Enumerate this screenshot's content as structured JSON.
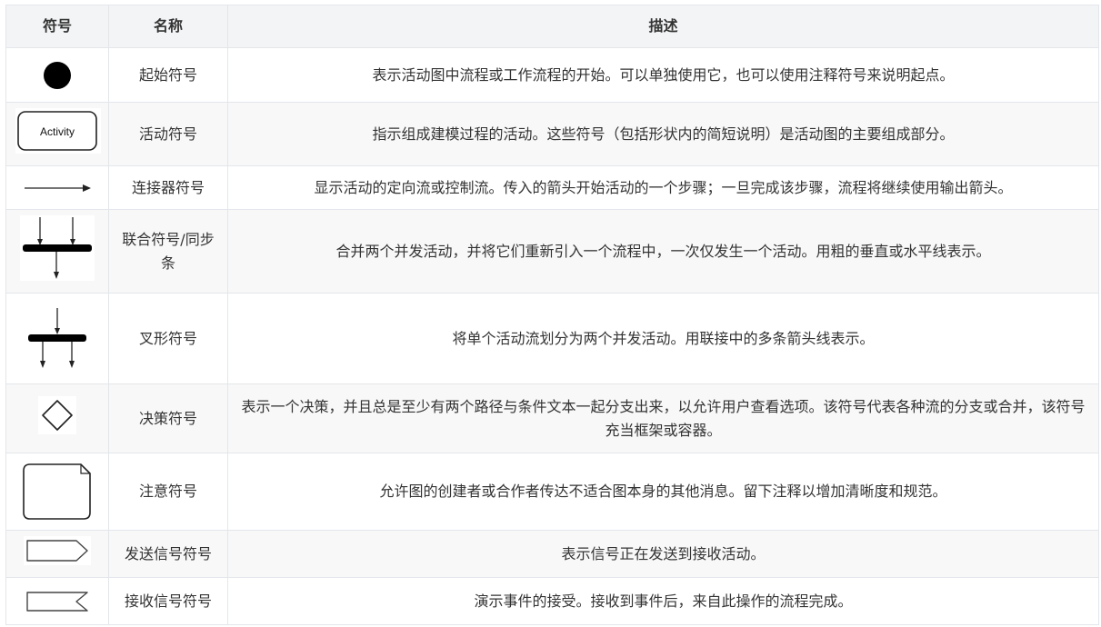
{
  "table": {
    "headers": {
      "symbol": "符号",
      "name": "名称",
      "description": "描述"
    },
    "rows": [
      {
        "icon": "filled-circle-icon",
        "name": "起始符号",
        "description": "表示活动图中流程或工作流程的开始。可以单独使用它，也可以使用注释符号来说明起点。"
      },
      {
        "icon": "activity-rounded-rect-icon",
        "icon_text": "Activity",
        "name": "活动符号",
        "description": "指示组成建模过程的活动。这些符号（包括形状内的简短说明）是活动图的主要组成部分。"
      },
      {
        "icon": "arrow-right-icon",
        "name": "连接器符号",
        "description": "显示活动的定向流或控制流。传入的箭头开始活动的一个步骤；一旦完成该步骤，流程将继续使用输出箭头。"
      },
      {
        "icon": "join-bar-icon",
        "name": "联合符号/同步条",
        "description": "合并两个并发活动，并将它们重新引入一个流程中，一次仅发生一个活动。用粗的垂直或水平线表示。"
      },
      {
        "icon": "fork-bar-icon",
        "name": "叉形符号",
        "description": "将单个活动流划分为两个并发活动。用联接中的多条箭头线表示。"
      },
      {
        "icon": "diamond-icon",
        "name": "决策符号",
        "description": "表示一个决策，并且总是至少有两个路径与条件文本一起分支出来，以允许用户查看选项。该符号代表各种流的分支或合并，该符号充当框架或容器。"
      },
      {
        "icon": "note-icon",
        "name": "注意符号",
        "description": "允许图的创建者或合作者传达不适合图本身的其他消息。留下注释以增加清晰度和规范。"
      },
      {
        "icon": "send-signal-icon",
        "name": "发送信号符号",
        "description": "表示信号正在发送到接收活动。"
      },
      {
        "icon": "receive-signal-icon",
        "name": "接收信号符号",
        "description": "演示事件的接受。接收到事件后，来自此操作的流程完成。"
      }
    ]
  }
}
